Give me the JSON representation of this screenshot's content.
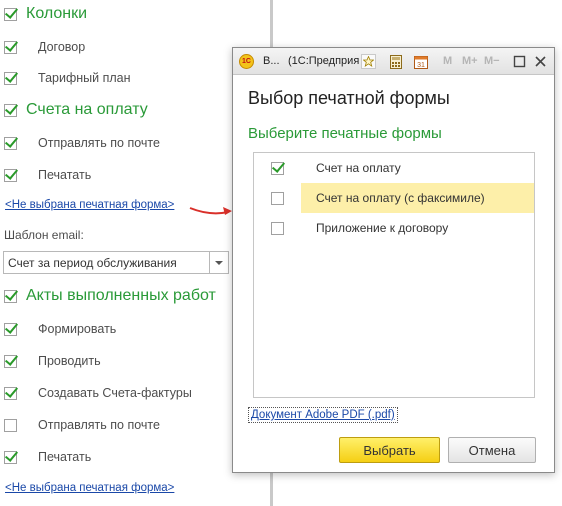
{
  "left": {
    "sections": {
      "columns": "Колонки",
      "invoices": "Счета на оплату",
      "acts": "Акты выполненных работ"
    },
    "items": {
      "contract": {
        "label": "Договор",
        "checked": true
      },
      "tariff": {
        "label": "Тарифный план",
        "checked": true
      },
      "inv_send": {
        "label": "Отправлять по почте",
        "checked": true
      },
      "inv_print": {
        "label": "Печатать",
        "checked": true
      },
      "act_form": {
        "label": "Формировать",
        "checked": true
      },
      "act_post": {
        "label": "Проводить",
        "checked": true
      },
      "act_create_inv": {
        "label": "Создавать Счета-фактуры",
        "checked": true
      },
      "act_send": {
        "label": "Отправлять по почте",
        "checked": false
      },
      "act_print": {
        "label": "Печатать",
        "checked": true
      }
    },
    "print_form_link_1": "<Не выбрана печатная форма>",
    "print_form_link_2": "<Не выбрана печатная форма>",
    "email_template_label": "Шаблон email:",
    "email_template_value": "Счет за период обслуживания"
  },
  "dialog": {
    "title_short": "В...",
    "title_app": "(1С:Предприя",
    "toolbar": {
      "m": "M",
      "m_plus": "M+",
      "m_minus": "M−"
    },
    "heading": "Выбор печатной формы",
    "subheading": "Выберите печатные формы",
    "forms": [
      {
        "label": "Счет на оплату",
        "checked": true,
        "selected": false
      },
      {
        "label": "Счет на оплату (с факсимиле)",
        "checked": false,
        "selected": true
      },
      {
        "label": "Приложение к договору",
        "checked": false,
        "selected": false
      }
    ],
    "format_link": "Документ Adobe PDF (.pdf)",
    "ok_label": "Выбрать",
    "cancel_label": "Отмена"
  },
  "colors": {
    "accent_green": "#2a9a38",
    "link_blue": "#1a48a8",
    "selection_yellow": "#fdefa9",
    "arrow_red": "#d9302a"
  }
}
